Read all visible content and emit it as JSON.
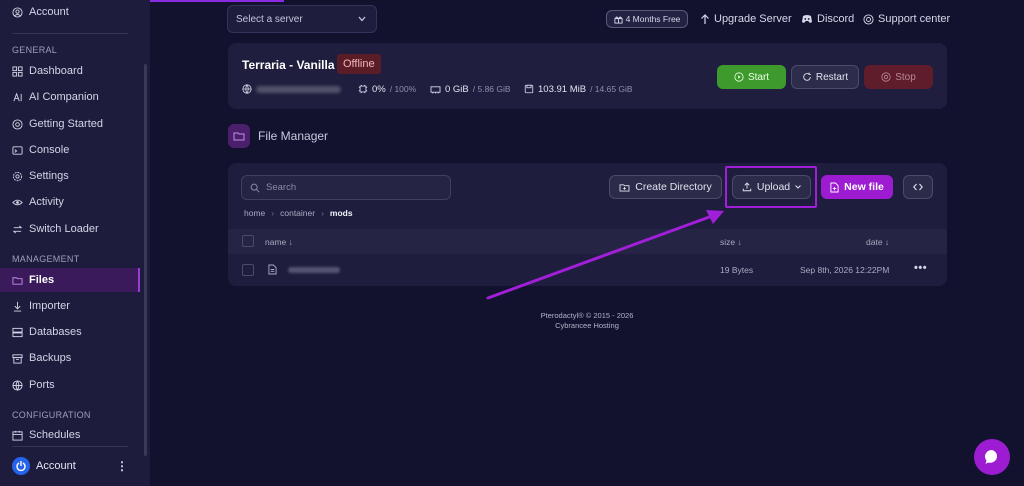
{
  "sidebar": {
    "top_account": "Account",
    "section_general": "GENERAL",
    "section_management": "MANAGEMENT",
    "section_configuration": "CONFIGURATION",
    "items": [
      {
        "label": "Dashboard",
        "icon": "dashboard-icon"
      },
      {
        "label": "AI Companion",
        "icon": "ai-companion-icon"
      },
      {
        "label": "Getting Started",
        "icon": "getting-started-icon"
      },
      {
        "label": "Console",
        "icon": "console-icon"
      },
      {
        "label": "Settings",
        "icon": "gear-icon"
      },
      {
        "label": "Activity",
        "icon": "eye-icon"
      },
      {
        "label": "Switch Loader",
        "icon": "switch-icon"
      },
      {
        "label": "Files",
        "icon": "folder-icon",
        "active": true
      },
      {
        "label": "Importer",
        "icon": "download-icon"
      },
      {
        "label": "Databases",
        "icon": "database-icon"
      },
      {
        "label": "Backups",
        "icon": "archive-icon"
      },
      {
        "label": "Ports",
        "icon": "globe-icon"
      },
      {
        "label": "Schedules",
        "icon": "calendar-icon"
      }
    ],
    "bottom_account": "Account",
    "accent": "#9b3bd6"
  },
  "header": {
    "server_select_placeholder": "Select a server",
    "promo_badge": "4 Months Free",
    "upgrade": "Upgrade Server",
    "discord": "Discord",
    "support": "Support center"
  },
  "server": {
    "name": "Terraria - Vanilla",
    "status": "Offline",
    "cpu": "0%",
    "cpu_limit": "/ 100%",
    "memory": "0 GiB",
    "memory_limit": "/ 5.86 GiB",
    "disk": "103.91 MiB",
    "disk_limit": "/ 14.65 GiB",
    "start": "Start",
    "restart": "Restart",
    "stop": "Stop",
    "colors": {
      "start": "#3e9a2d",
      "stop": "#5f1d2c",
      "offline": "#5a1c26"
    }
  },
  "file_manager": {
    "title": "File Manager",
    "search_placeholder": "Search",
    "create_directory": "Create Directory",
    "upload": "Upload",
    "new_file": "New file",
    "breadcrumb": [
      "home",
      "container",
      "mods"
    ],
    "columns": {
      "name": "name ↓",
      "size": "size ↓",
      "date": "date ↓"
    },
    "files": [
      {
        "size": "19 Bytes",
        "date": "Sep 8th, 2026 12:22PM"
      }
    ]
  },
  "footer": {
    "line1": "Pterodactyl® © 2015 - 2026",
    "line2": "Cybrancee Hosting"
  }
}
